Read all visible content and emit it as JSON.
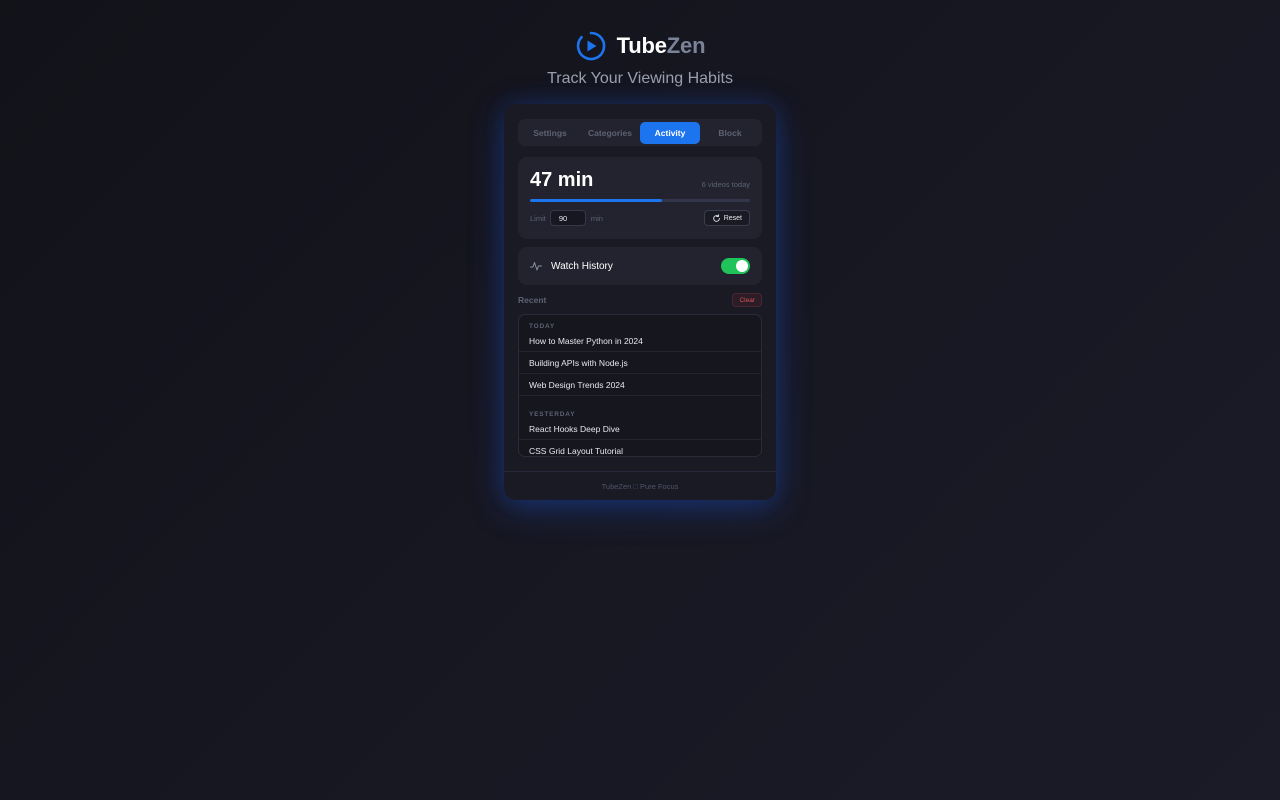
{
  "header": {
    "brand_part1": "Tube",
    "brand_part2": "Zen",
    "subtitle": "Track Your Viewing Habits",
    "logo_icon": "play-circle-icon",
    "accent_color": "#1d74ef"
  },
  "tabs": [
    {
      "label": "Settings",
      "active": false
    },
    {
      "label": "Categories",
      "active": false
    },
    {
      "label": "Activity",
      "active": true
    },
    {
      "label": "Block",
      "active": false
    }
  ],
  "stats": {
    "minutes": "47 min",
    "videos": "6 videos today",
    "progress_fraction": 0.6,
    "limit_label": "Limit",
    "limit_value": "90",
    "limit_unit": "min",
    "reset_label": "Reset",
    "reset_icon": "refresh-icon"
  },
  "watch_history": {
    "label": "Watch History",
    "icon": "pulse-icon",
    "enabled": true,
    "toggle_color": "#1fc35a"
  },
  "recent": {
    "label": "Recent",
    "clear_label": "Clear",
    "groups": [
      {
        "label": "TODAY",
        "items": [
          "How to Master Python in 2024",
          "Building APIs with Node.js",
          "Web Design Trends 2024"
        ]
      },
      {
        "label": "YESTERDAY",
        "items": [
          "React Hooks Deep Dive",
          "CSS Grid Layout Tutorial"
        ]
      }
    ]
  },
  "footer": {
    "text": "TubeZen □ Pure Focus"
  }
}
